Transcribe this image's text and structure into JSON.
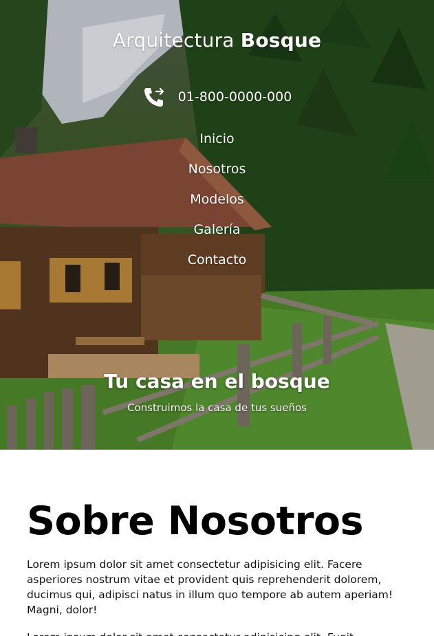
{
  "header": {
    "brand_light": "Arquitectura",
    "brand_bold": "Bosque",
    "phone": "01-800-0000-000",
    "phone_icon": "phone-forward-icon"
  },
  "nav": {
    "items": [
      {
        "label": "Inicio"
      },
      {
        "label": "Nosotros"
      },
      {
        "label": "Modelos"
      },
      {
        "label": "Galería"
      },
      {
        "label": "Contacto"
      }
    ]
  },
  "hero": {
    "title": "Tu casa en el bosque",
    "subtitle": "Construimos la casa de tus sueños"
  },
  "about": {
    "heading": "Sobre Nosotros",
    "paragraphs": [
      "Lorem ipsum dolor sit amet consectetur adipisicing elit. Facere asperiores nostrum vitae et provident quis reprehenderit dolorem, ducimus qui, adipisci natus in illum quo tempore ab autem aperiam! Magni, dolor!",
      "Lorem ipsum dolor sit amet consectetur adipisicing elit. Fugit molestiae"
    ]
  },
  "colors": {
    "text_on_hero": "#ffffff",
    "body_text": "#000000",
    "background": "#ffffff"
  }
}
